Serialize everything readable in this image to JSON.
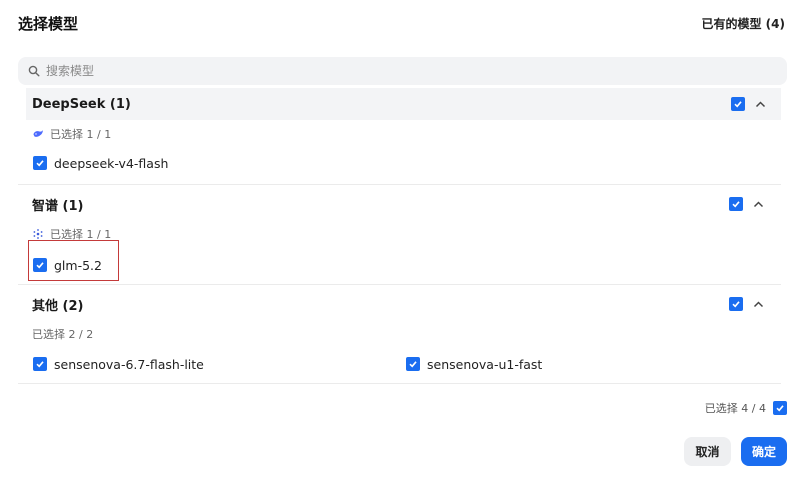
{
  "dialog": {
    "title": "选择模型",
    "owned_label": "已有的模型 (4)"
  },
  "search": {
    "placeholder": "搜索模型"
  },
  "groups": [
    {
      "title": "DeepSeek (1)",
      "selected_text": "已选择 1 / 1",
      "vendor_icon": "deepseek-whale-icon",
      "models": [
        {
          "name": "deepseek-v4-flash",
          "checked": true
        }
      ]
    },
    {
      "title": "智谱 (1)",
      "selected_text": "已选择 1 / 1",
      "vendor_icon": "zhipu-icon",
      "models": [
        {
          "name": "glm-5.2",
          "checked": true
        }
      ]
    },
    {
      "title": "其他 (2)",
      "selected_text": "已选择 2 / 2",
      "models": [
        {
          "name": "sensenova-6.7-flash-lite",
          "checked": true
        },
        {
          "name": "sensenova-u1-fast",
          "checked": true
        }
      ]
    }
  ],
  "footer": {
    "summary": "已选择 4 / 4",
    "cancel_label": "取消",
    "confirm_label": "确定"
  },
  "colors": {
    "accent": "#1a6df0",
    "highlight_border": "#c43a3a"
  }
}
